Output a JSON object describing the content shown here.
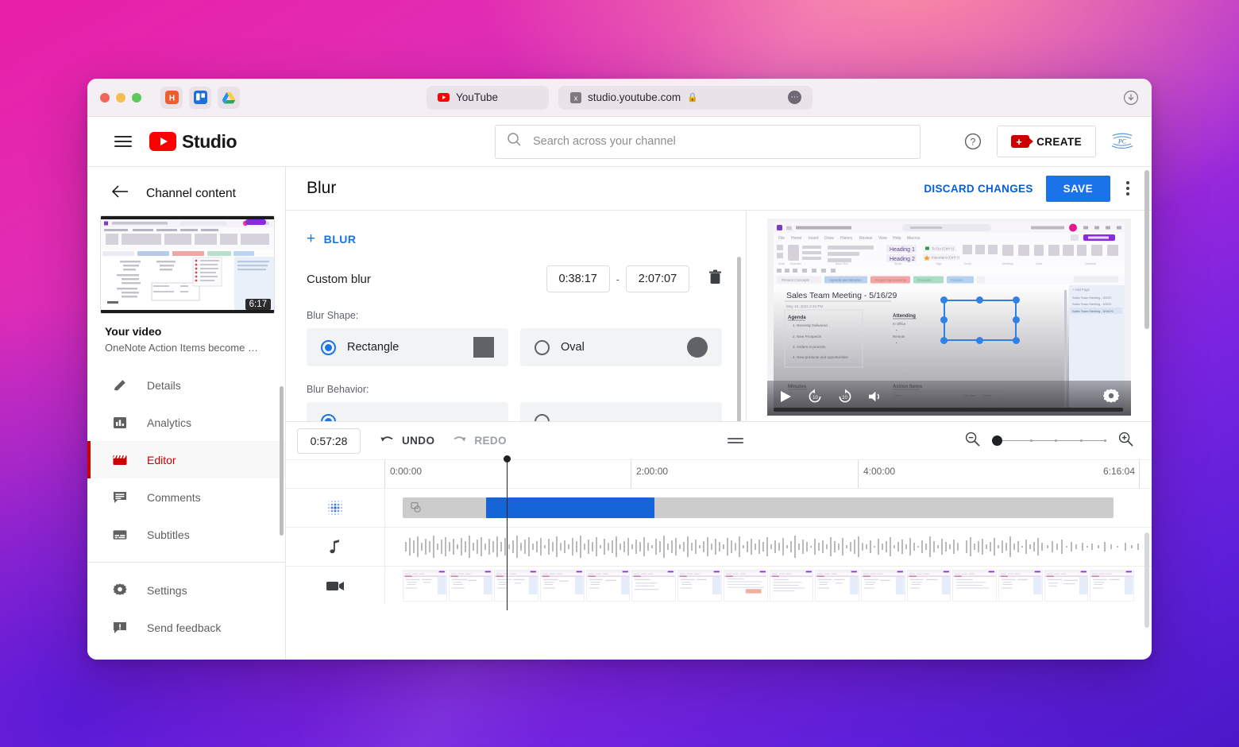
{
  "browser": {
    "apps": [
      {
        "name": "app-icon-h",
        "label": "H"
      },
      {
        "name": "app-icon-trello",
        "label": ""
      },
      {
        "name": "app-icon-drive",
        "label": ""
      }
    ],
    "tabs": [
      {
        "title": "YouTube",
        "favicon": "youtube-icon",
        "secure": false
      },
      {
        "title": "studio.youtube.com",
        "favicon": "studio-icon",
        "secure": true,
        "active": true
      }
    ],
    "download_icon": "download-icon"
  },
  "header": {
    "menu_icon": "hamburger-icon",
    "brand": "Studio",
    "search": {
      "placeholder": "Search across your channel",
      "value": "",
      "icon": "search-icon"
    },
    "help_icon": "help-icon",
    "create_label": "CREATE",
    "avatar_label": "PC"
  },
  "sidebar": {
    "back_label": "Channel content",
    "thumbnail_duration": "6:17",
    "video_heading": "Your video",
    "video_title": "OneNote Action Items become Outl…",
    "items": [
      {
        "label": "Details",
        "icon": "pencil-icon",
        "active": false
      },
      {
        "label": "Analytics",
        "icon": "bar-chart-icon",
        "active": false
      },
      {
        "label": "Editor",
        "icon": "clapperboard-icon",
        "active": true
      },
      {
        "label": "Comments",
        "icon": "comment-icon",
        "active": false
      },
      {
        "label": "Subtitles",
        "icon": "subtitles-icon",
        "active": false
      }
    ],
    "footer_items": [
      {
        "label": "Settings",
        "icon": "gear-icon"
      },
      {
        "label": "Send feedback",
        "icon": "feedback-icon"
      }
    ]
  },
  "editor": {
    "title": "Blur",
    "discard_label": "DISCARD CHANGES",
    "save_label": "SAVE",
    "more_icon": "kebab-icon"
  },
  "blur_panel": {
    "add_blur_label": "BLUR",
    "add_blur_plus": "+",
    "item_name": "Custom blur",
    "start_time": "0:38:17",
    "end_time": "2:07:07",
    "time_separator": "-",
    "delete_icon": "trash-icon",
    "shape_label": "Blur Shape:",
    "shape_options": [
      {
        "label": "Rectangle",
        "selected": true,
        "shape": "square"
      },
      {
        "label": "Oval",
        "selected": false,
        "shape": "circle"
      }
    ],
    "behavior_label": "Blur Behavior:"
  },
  "player": {
    "play_icon": "play-icon",
    "rewind_icon": "rewind-10-icon",
    "forward_icon": "forward-10-icon",
    "volume_icon": "volume-icon",
    "settings_icon": "gear-icon",
    "doc_title": "Sales Team Meeting - 5/16/29",
    "doc_subtitle": "May 16, 2022      3:42 PM",
    "doc_sections": [
      "Agenda",
      "Attending",
      "Minutes",
      "Action Items"
    ],
    "agenda_items": [
      "1.   Recently Delivered",
      "2.   New Prospects",
      "3.   Orders in process",
      "4.   New products and opportunities"
    ],
    "attending_sub": [
      "In Office",
      "Remote"
    ],
    "action_table_headers": [
      "Item",
      "Due date",
      "Owner"
    ]
  },
  "timeline": {
    "current_time": "0:57:28",
    "undo_label": "UNDO",
    "redo_label": "REDO",
    "drag_handle_icon": "drag-handle-icon",
    "zoom_out_icon": "zoom-out-icon",
    "zoom_in_icon": "zoom-in-icon",
    "zoom_value": 0,
    "ruler_marks": [
      "0:00:00",
      "2:00:00",
      "4:00:00",
      "6:16:04"
    ],
    "total_duration": "6:16:04",
    "playhead_time": "0:57:28",
    "tracks": [
      {
        "name": "blur-track",
        "icon": "blur-dots-icon"
      },
      {
        "name": "audio-track",
        "icon": "music-note-icon"
      },
      {
        "name": "video-track",
        "icon": "video-camera-icon"
      }
    ],
    "blur_clip": {
      "start_pct": 12.0,
      "end_pct": 35.0,
      "color": "#1565d8"
    }
  },
  "colors": {
    "accent_blue": "#1a73e8",
    "youtube_red": "#cc0000",
    "clip_blue": "#1565d8",
    "muted_text": "#5f6368"
  }
}
